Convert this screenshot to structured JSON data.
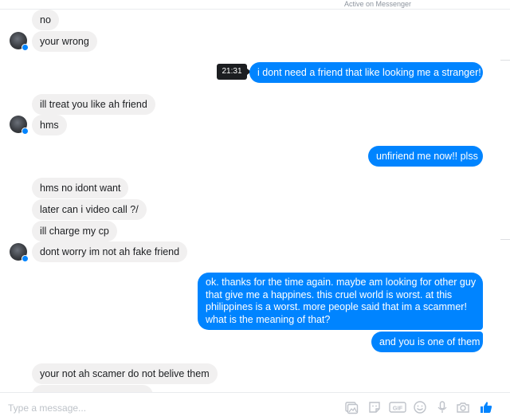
{
  "header": {
    "status_text": "Active on Messenger"
  },
  "messages": [
    {
      "from": "them",
      "text": "no"
    },
    {
      "from": "them",
      "text": "your wrong"
    },
    {
      "from": "me",
      "text": "i dont need a friend that like looking me a stranger!",
      "time": "21:31"
    },
    {
      "from": "them",
      "text": "ill treat you like ah friend"
    },
    {
      "from": "them",
      "text": "hms"
    },
    {
      "from": "me",
      "text": "unfiriend me now!! plss"
    },
    {
      "from": "them",
      "text": "hms no idont want"
    },
    {
      "from": "them",
      "text": "later can i video call ?/"
    },
    {
      "from": "them",
      "text": "ill charge my cp"
    },
    {
      "from": "them",
      "text": "dont worry im not ah fake friend"
    },
    {
      "from": "me",
      "lines": [
        "ok. thanks for the time again. maybe am looking for other guy",
        "that give me a happines. this cruel world is worst. at this",
        "philippines is a worst. more people said that im a scammer!",
        "what is the meaning of that?"
      ]
    },
    {
      "from": "me",
      "text": "and you is one of them"
    },
    {
      "from": "them",
      "text": "your not ah scamer do not belive them"
    }
  ],
  "composer": {
    "placeholder": "Type a message...",
    "tools": [
      "attach-file-icon",
      "sticker-icon",
      "gif-icon",
      "emoji-icon",
      "microphone-icon",
      "camera-icon",
      "like-thumb-icon"
    ],
    "accent_color": "#0084ff"
  }
}
